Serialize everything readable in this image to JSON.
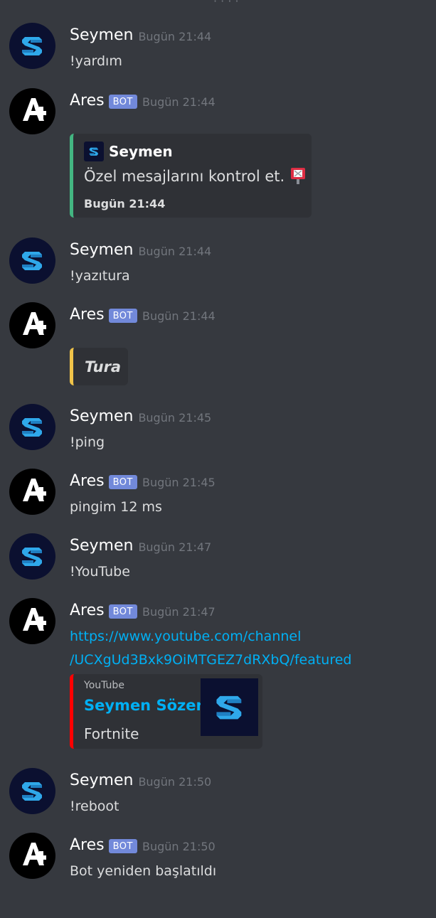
{
  "messages": [
    {
      "author": "Seymen",
      "timestamp": "Bugün 21:44",
      "text": "!yardım"
    },
    {
      "author": "Ares",
      "bot_tag": "BOT",
      "timestamp": "Bugün 21:44",
      "embed": {
        "author": "Seymen",
        "description": "Özel mesajlarını kontrol et.",
        "footer": "Bugün 21:44",
        "color": "#43b581",
        "emoji_icon": "mailbox-icon"
      }
    },
    {
      "author": "Seymen",
      "timestamp": "Bugün 21:44",
      "text": "!yazıtura"
    },
    {
      "author": "Ares",
      "bot_tag": "BOT",
      "timestamp": "Bugün 21:44",
      "embed": {
        "description": "Tura",
        "color": "#f0c349"
      }
    },
    {
      "author": "Seymen",
      "timestamp": "Bugün 21:45",
      "text": "!ping"
    },
    {
      "author": "Ares",
      "bot_tag": "BOT",
      "timestamp": "Bugün 21:45",
      "text": "pingim 12 ms"
    },
    {
      "author": "Seymen",
      "timestamp": "Bugün 21:47",
      "text": "!YouTube"
    },
    {
      "author": "Ares",
      "bot_tag": "BOT",
      "timestamp": "Bugün 21:47",
      "link_line1": "https://www.youtube.com/channel",
      "link_line2": "/UCXgUd3Bxk9OiMTGEZ7dRXbQ/featured",
      "embed": {
        "provider": "YouTube",
        "title": "Seymen Sözen",
        "description": "Fortnite",
        "color": "#ff0000"
      }
    },
    {
      "author": "Seymen",
      "timestamp": "Bugün 21:50",
      "text": "!reboot"
    },
    {
      "author": "Ares",
      "bot_tag": "BOT",
      "timestamp": "Bugün 21:50",
      "text": "Bot yeniden başlatıldı"
    }
  ],
  "colors": {
    "background": "#36393f",
    "embed_background": "#2f3136",
    "bot_tag": "#7289da",
    "link": "#00b0f4",
    "timestamp": "#72767d"
  }
}
